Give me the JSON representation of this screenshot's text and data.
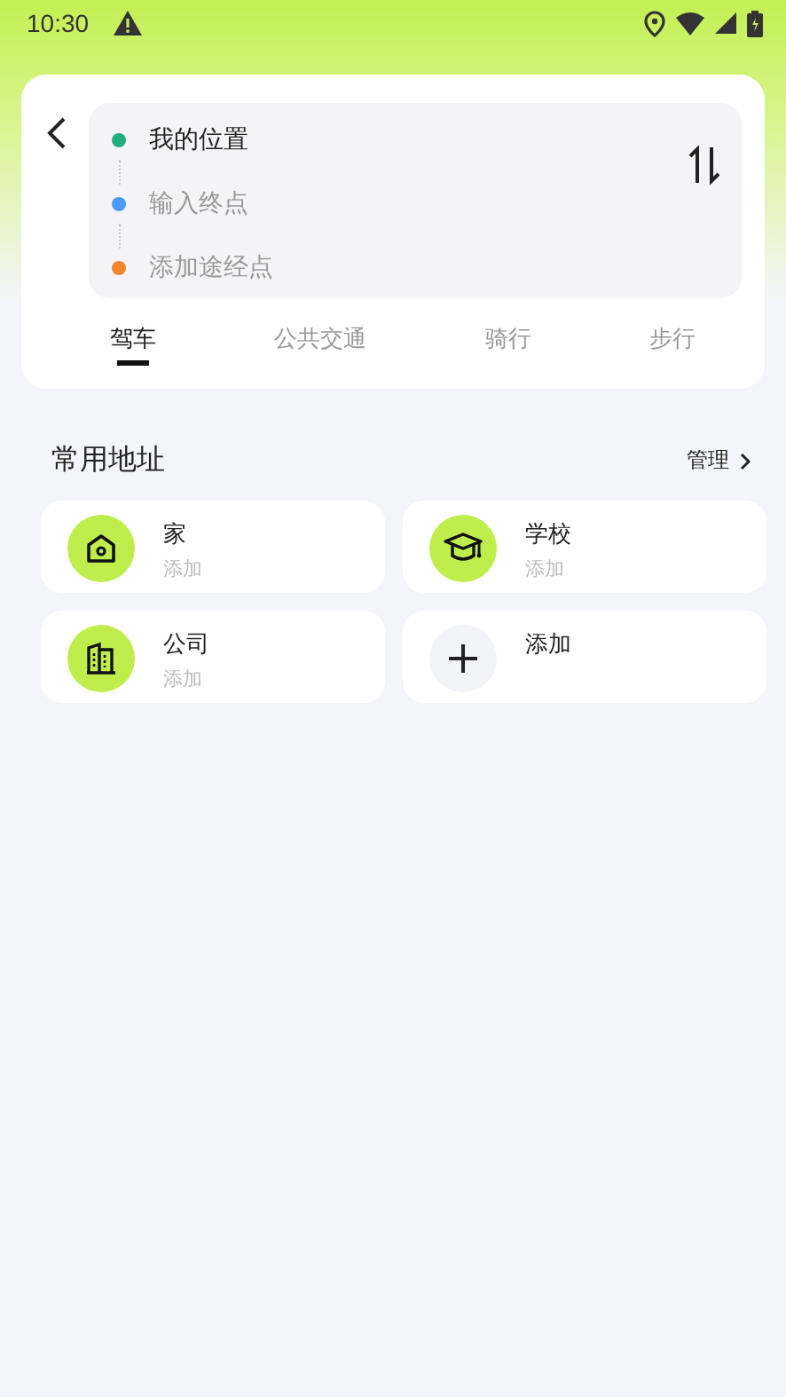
{
  "status_bar": {
    "time": "10:30"
  },
  "route": {
    "stops": [
      {
        "kind": "value",
        "text": "我的位置",
        "color": "#1fae7e"
      },
      {
        "kind": "placeholder",
        "text": "输入终点",
        "color": "#4a9bf5"
      },
      {
        "kind": "placeholder",
        "text": "添加途经点",
        "color": "#f5862e"
      }
    ]
  },
  "tabs": [
    {
      "label": "驾车",
      "selected": true
    },
    {
      "label": "公共交通",
      "selected": false
    },
    {
      "label": "骑行",
      "selected": false
    },
    {
      "label": "步行",
      "selected": false
    }
  ],
  "addresses": {
    "title": "常用地址",
    "manage": "管理",
    "items": [
      {
        "kind": "home",
        "name": "家",
        "hint": "添加"
      },
      {
        "kind": "school",
        "name": "学校",
        "hint": "添加"
      },
      {
        "kind": "company",
        "name": "公司",
        "hint": "添加"
      },
      {
        "kind": "add",
        "name": "添加"
      }
    ]
  }
}
